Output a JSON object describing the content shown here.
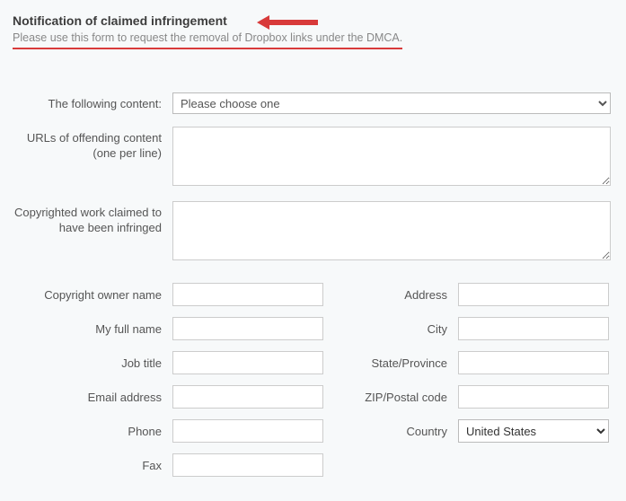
{
  "header": {
    "title": "Notification of claimed infringement",
    "subtitle": "Please use this form to request the removal of Dropbox links under the DMCA."
  },
  "form": {
    "content_type": {
      "label": "The following content:",
      "placeholder": "Please choose one",
      "value": "Please choose one"
    },
    "offending_urls": {
      "label": "URLs of offending content (one per line)",
      "value": ""
    },
    "copyrighted_work": {
      "label": "Copyrighted work claimed to have been infringed",
      "value": ""
    },
    "left": {
      "owner_name": {
        "label": "Copyright owner name",
        "value": ""
      },
      "full_name": {
        "label": "My full name",
        "value": ""
      },
      "job_title": {
        "label": "Job title",
        "value": ""
      },
      "email": {
        "label": "Email address",
        "value": ""
      },
      "phone": {
        "label": "Phone",
        "value": ""
      },
      "fax": {
        "label": "Fax",
        "value": ""
      }
    },
    "right": {
      "address": {
        "label": "Address",
        "value": ""
      },
      "city": {
        "label": "City",
        "value": ""
      },
      "state": {
        "label": "State/Province",
        "value": ""
      },
      "zip": {
        "label": "ZIP/Postal code",
        "value": ""
      },
      "country": {
        "label": "Country",
        "value": "United States"
      }
    }
  }
}
